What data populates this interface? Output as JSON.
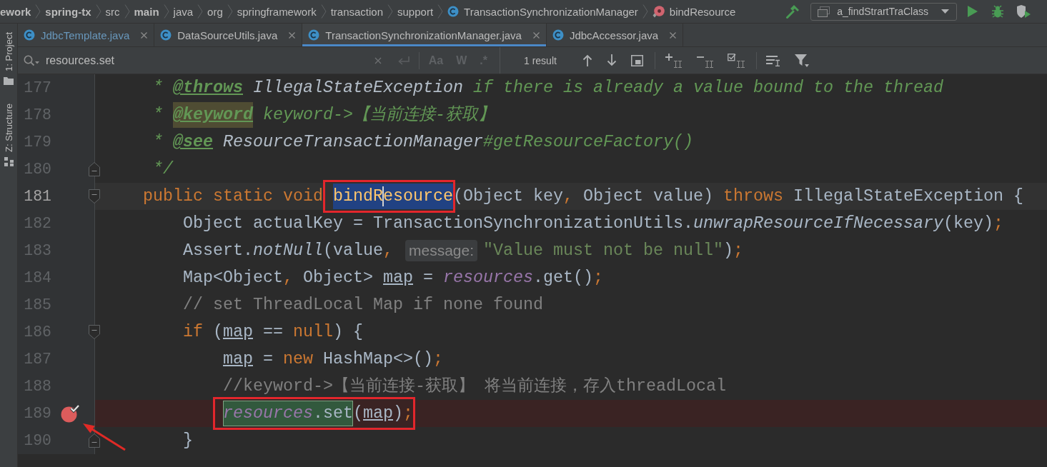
{
  "breadcrumbs": [
    {
      "label": "ework",
      "kind": "module"
    },
    {
      "label": "spring-tx",
      "kind": "module"
    },
    {
      "label": "src",
      "kind": "folder"
    },
    {
      "label": "main",
      "kind": "module"
    },
    {
      "label": "java",
      "kind": "folder"
    },
    {
      "label": "org",
      "kind": "package"
    },
    {
      "label": "springframework",
      "kind": "package"
    },
    {
      "label": "transaction",
      "kind": "package"
    },
    {
      "label": "support",
      "kind": "package"
    },
    {
      "label": "TransactionSynchronizationManager",
      "kind": "class"
    },
    {
      "label": "bindResource",
      "kind": "method"
    }
  ],
  "run_configuration": {
    "label": "a_findStrartTraClass"
  },
  "tool_windows": [
    {
      "label": "1: Project",
      "kind": "project"
    },
    {
      "label": "Z: Structure",
      "kind": "structure"
    }
  ],
  "tabs": [
    {
      "label": "JdbcTemplate.java",
      "selected": false,
      "modified": true
    },
    {
      "label": "DataSourceUtils.java",
      "selected": false,
      "modified": false
    },
    {
      "label": "TransactionSynchronizationManager.java",
      "selected": true,
      "modified": false
    },
    {
      "label": "JdbcAccessor.java",
      "selected": false,
      "modified": false
    }
  ],
  "search": {
    "query": "resources.set",
    "options": [
      {
        "label": "Aa",
        "on": false
      },
      {
        "label": "W",
        "on": false
      },
      {
        "label": ".*",
        "on": false
      }
    ],
    "result": "1 result"
  },
  "editor": {
    "lines": [
      {
        "number": "177",
        "current": false,
        "tokens": [
          {
            "text": "     * ",
            "kind": "doc"
          },
          {
            "text": "@throws",
            "kind": "doc-tag"
          },
          {
            "text": " IllegalStateException",
            "kind": "doc-ref"
          },
          {
            "text": " if there is already a value bound to the thread",
            "kind": "doc"
          }
        ]
      },
      {
        "number": "178",
        "current": false,
        "tokens": [
          {
            "text": "     * ",
            "kind": "doc"
          },
          {
            "kind": "warning-highlight",
            "tokens": [
              {
                "text": "@keyword",
                "kind": "doc-tag"
              }
            ]
          },
          {
            "text": " keyword->【当前连接-获取】",
            "kind": "doc"
          }
        ]
      },
      {
        "number": "179",
        "current": false,
        "tokens": [
          {
            "text": "     * ",
            "kind": "doc"
          },
          {
            "text": "@see",
            "kind": "doc-tag"
          },
          {
            "text": " ResourceTransactionManager",
            "kind": "doc-ref"
          },
          {
            "text": "#getResourceFactory()",
            "kind": "doc"
          }
        ]
      },
      {
        "number": "180",
        "current": false,
        "gutter": [
          {
            "kind": "fold-end"
          }
        ],
        "tokens": [
          {
            "text": "     */",
            "kind": "doc"
          }
        ]
      },
      {
        "number": "181",
        "current": true,
        "gutter": [
          {
            "kind": "fold-start"
          }
        ],
        "tokens": [
          {
            "text": "    public static void ",
            "kind": "keyword"
          },
          {
            "kind": "annotation-box",
            "tokens": [
              {
                "kind": "selection",
                "tokens": [
                  {
                    "text": "bindR",
                    "kind": "method-decl"
                  },
                  {
                    "kind": "caret"
                  },
                  {
                    "text": "esource",
                    "kind": "method-decl"
                  }
                ]
              }
            ]
          },
          {
            "text": "(Object key",
            "kind": "plain"
          },
          {
            "text": ",",
            "kind": "punctuation"
          },
          {
            "text": " Object value) ",
            "kind": "plain"
          },
          {
            "text": "throws",
            "kind": "keyword"
          },
          {
            "text": " IllegalStateException {",
            "kind": "plain"
          }
        ]
      },
      {
        "number": "182",
        "current": false,
        "tokens": [
          {
            "text": "        Object actualKey = TransactionSynchronizationUtils.",
            "kind": "plain"
          },
          {
            "text": "unwrapResourceIfNecessary",
            "kind": "static-call"
          },
          {
            "text": "(key)",
            "kind": "plain"
          },
          {
            "text": ";",
            "kind": "punctuation"
          }
        ]
      },
      {
        "number": "183",
        "current": false,
        "tokens": [
          {
            "text": "        Assert.",
            "kind": "plain"
          },
          {
            "text": "notNull",
            "kind": "static-call"
          },
          {
            "text": "(value",
            "kind": "plain"
          },
          {
            "text": ", ",
            "kind": "punctuation"
          },
          {
            "text": "message:",
            "kind": "hint"
          },
          {
            "text": "\"Value must not be null\"",
            "kind": "string"
          },
          {
            "text": ")",
            "kind": "plain"
          },
          {
            "text": ";",
            "kind": "punctuation"
          }
        ]
      },
      {
        "number": "184",
        "current": false,
        "tokens": [
          {
            "text": "        Map<Object",
            "kind": "plain"
          },
          {
            "text": ",",
            "kind": "punctuation"
          },
          {
            "text": " Object> ",
            "kind": "plain"
          },
          {
            "text": "map",
            "kind": "reassigned-var"
          },
          {
            "text": " = ",
            "kind": "plain"
          },
          {
            "text": "resources",
            "kind": "static-field"
          },
          {
            "text": ".get()",
            "kind": "plain"
          },
          {
            "text": ";",
            "kind": "punctuation"
          }
        ]
      },
      {
        "number": "185",
        "current": false,
        "tokens": [
          {
            "text": "        // set ThreadLocal Map if none found",
            "kind": "comment"
          }
        ]
      },
      {
        "number": "186",
        "current": false,
        "gutter": [
          {
            "kind": "fold-start"
          }
        ],
        "tokens": [
          {
            "text": "        if",
            "kind": "keyword"
          },
          {
            "text": " (",
            "kind": "plain"
          },
          {
            "text": "map",
            "kind": "reassigned-var"
          },
          {
            "text": " == ",
            "kind": "plain"
          },
          {
            "text": "null",
            "kind": "keyword"
          },
          {
            "text": ") {",
            "kind": "plain"
          }
        ]
      },
      {
        "number": "187",
        "current": false,
        "tokens": [
          {
            "text": "            map",
            "kind": "reassigned-var"
          },
          {
            "text": " = ",
            "kind": "plain"
          },
          {
            "text": "new",
            "kind": "keyword"
          },
          {
            "text": " HashMap<>()",
            "kind": "plain"
          },
          {
            "text": ";",
            "kind": "punctuation"
          }
        ]
      },
      {
        "number": "188",
        "current": false,
        "tokens": [
          {
            "text": "            //keyword->【当前连接-获取】 将当前连接，存入threadLocal",
            "kind": "comment"
          }
        ]
      },
      {
        "number": "189",
        "current": false,
        "gutter": [
          {
            "kind": "breakpoint"
          },
          {
            "kind": "arrow"
          }
        ],
        "tokens": [
          {
            "kind": "annotation-box",
            "tokens": [
              {
                "kind": "search-match",
                "tokens": [
                  {
                    "text": "            resources",
                    "kind": "static-field"
                  },
                  {
                    "text": ".set",
                    "kind": "plain"
                  }
                ]
              },
              {
                "text": "(",
                "kind": "plain"
              },
              {
                "text": "map",
                "kind": "reassigned-var"
              },
              {
                "text": ")",
                "kind": "plain"
              },
              {
                "text": ";",
                "kind": "punctuation"
              }
            ]
          }
        ]
      },
      {
        "number": "190",
        "current": false,
        "gutter": [
          {
            "kind": "fold-end"
          }
        ],
        "tokens": [
          {
            "text": "        }",
            "kind": "plain"
          }
        ]
      }
    ]
  }
}
